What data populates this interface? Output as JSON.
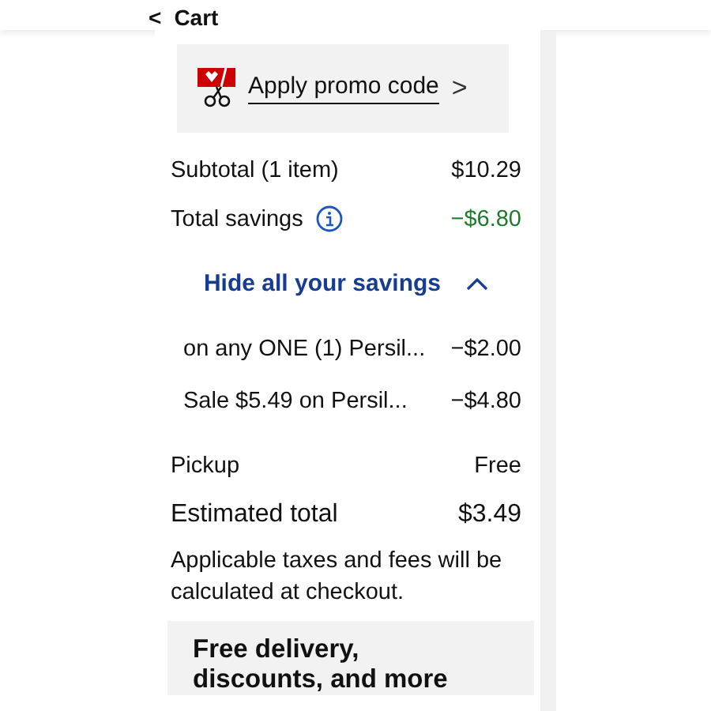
{
  "header": {
    "back": "<",
    "title": "Cart"
  },
  "promo": {
    "label": "Apply promo code",
    "chevron": ">"
  },
  "summary": [
    {
      "label": "Subtotal (1 item)",
      "value": "$10.29",
      "kind": "plain"
    },
    {
      "label": "Total savings",
      "value": "−$6.80",
      "kind": "savings"
    }
  ],
  "savings_toggle": {
    "label": "Hide all your savings",
    "expanded": true
  },
  "savings": [
    {
      "label": "on any ONE (1) Persil...",
      "value": "−$2.00"
    },
    {
      "label": "Sale $5.49 on Persil...",
      "value": "−$4.80"
    }
  ],
  "pickup": {
    "label": "Pickup",
    "value": "Free"
  },
  "total": {
    "label": "Estimated total",
    "value": "$3.49"
  },
  "note": "Applicable taxes and fees will be calculated at checkout.",
  "banner": {
    "title": "Free delivery, discounts, and more"
  }
}
